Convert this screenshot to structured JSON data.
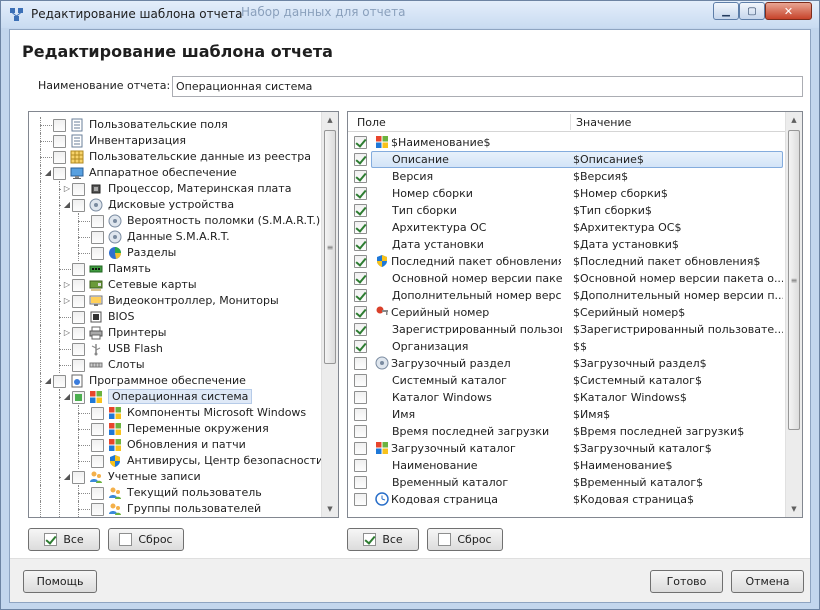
{
  "window": {
    "title": "Редактирование шаблона отчета",
    "ghost_title": "Набор данных для отчета",
    "buttons": {
      "min": "▁",
      "max": "▢",
      "close": "✕"
    }
  },
  "heading": "Редактирование шаблона отчета",
  "report_name": {
    "label": "Наименование отчета:",
    "value": "Операционная система"
  },
  "tree": {
    "items": [
      {
        "label": "Пользовательские поля",
        "level": 0,
        "state": "unchecked",
        "icon": "list-icon",
        "expand": ""
      },
      {
        "label": "Инвентаризация",
        "level": 0,
        "state": "unchecked",
        "icon": "list-icon",
        "expand": ""
      },
      {
        "label": "Пользовательские данные из реестра",
        "level": 0,
        "state": "unchecked",
        "icon": "grid-icon",
        "expand": ""
      },
      {
        "label": "Аппаратное обеспечение",
        "level": 0,
        "state": "unchecked",
        "icon": "monitor-icon",
        "expand": "◢"
      },
      {
        "label": "Процессор, Материнская плата",
        "level": 1,
        "state": "unchecked",
        "icon": "cpu-icon",
        "expand": "▷"
      },
      {
        "label": "Дисковые устройства",
        "level": 1,
        "state": "unchecked",
        "icon": "disk-icon",
        "expand": "◢"
      },
      {
        "label": "Вероятность поломки (S.M.A.R.T.)",
        "level": 2,
        "state": "unchecked",
        "icon": "disk-icon",
        "expand": ""
      },
      {
        "label": "Данные S.M.A.R.T.",
        "level": 2,
        "state": "unchecked",
        "icon": "disk-icon",
        "expand": ""
      },
      {
        "label": "Разделы",
        "level": 2,
        "state": "unchecked",
        "icon": "pie-icon",
        "expand": ""
      },
      {
        "label": "Память",
        "level": 1,
        "state": "unchecked",
        "icon": "memory-icon",
        "expand": ""
      },
      {
        "label": "Сетевые карты",
        "level": 1,
        "state": "unchecked",
        "icon": "network-card-icon",
        "expand": "▷"
      },
      {
        "label": "Видеоконтроллер, Мониторы",
        "level": 1,
        "state": "unchecked",
        "icon": "video-icon",
        "expand": "▷"
      },
      {
        "label": "BIOS",
        "level": 1,
        "state": "unchecked",
        "icon": "bios-icon",
        "expand": ""
      },
      {
        "label": "Принтеры",
        "level": 1,
        "state": "unchecked",
        "icon": "printer-icon",
        "expand": "▷"
      },
      {
        "label": "USB Flash",
        "level": 1,
        "state": "unchecked",
        "icon": "usb-icon",
        "expand": ""
      },
      {
        "label": "Слоты",
        "level": 1,
        "state": "unchecked",
        "icon": "slot-icon",
        "expand": ""
      },
      {
        "label": "Программное обеспечение",
        "level": 0,
        "state": "unchecked",
        "icon": "software-icon",
        "expand": "◢"
      },
      {
        "label": "Операционная система",
        "level": 1,
        "state": "partial",
        "icon": "windows-icon",
        "expand": "◢",
        "selected": true
      },
      {
        "label": "Компоненты Microsoft Windows",
        "level": 2,
        "state": "unchecked",
        "icon": "windows-icon",
        "expand": ""
      },
      {
        "label": "Переменные окружения",
        "level": 2,
        "state": "unchecked",
        "icon": "windows-icon",
        "expand": ""
      },
      {
        "label": "Обновления и патчи",
        "level": 2,
        "state": "unchecked",
        "icon": "windows-icon",
        "expand": ""
      },
      {
        "label": "Антивирусы, Центр безопасности",
        "level": 2,
        "state": "unchecked",
        "icon": "shield-icon",
        "expand": ""
      },
      {
        "label": "Учетные записи",
        "level": 1,
        "state": "unchecked",
        "icon": "users-icon",
        "expand": "◢"
      },
      {
        "label": "Текущий пользователь",
        "level": 2,
        "state": "unchecked",
        "icon": "users-icon",
        "expand": ""
      },
      {
        "label": "Группы пользователей",
        "level": 2,
        "state": "unchecked",
        "icon": "users-icon",
        "expand": ""
      }
    ]
  },
  "grid": {
    "headers": {
      "field": "Поле",
      "value": "Значение"
    },
    "rows": [
      {
        "field": "$Наименование$",
        "value": "",
        "checked": true,
        "icon": "windows-icon",
        "group": true
      },
      {
        "field": "Описание",
        "value": "$Описание$",
        "checked": true,
        "selected": true
      },
      {
        "field": "Версия",
        "value": "$Версия$",
        "checked": true
      },
      {
        "field": "Номер сборки",
        "value": "$Номер сборки$",
        "checked": true
      },
      {
        "field": "Тип сборки",
        "value": "$Тип сборки$",
        "checked": true
      },
      {
        "field": "Архитектура ОС",
        "value": "$Архитектура ОС$",
        "checked": true
      },
      {
        "field": "Дата установки",
        "value": "$Дата установки$",
        "checked": true
      },
      {
        "field": "Последний пакет обновления",
        "value": "$Последний пакет обновления$",
        "checked": true,
        "icon": "shield-icon",
        "group": true
      },
      {
        "field": "Основной номер версии пакета о...",
        "value": "$Основной номер версии пакета о...",
        "checked": true
      },
      {
        "field": "Дополнительный номер версии...",
        "value": "$Дополнительный номер версии п...",
        "checked": true
      },
      {
        "field": "Серийный номер",
        "value": "$Серийный номер$",
        "checked": true,
        "icon": "key-icon",
        "group": true
      },
      {
        "field": "Зарегистрированный пользов...",
        "value": "$Зарегистрированный пользовате...",
        "checked": true
      },
      {
        "field": "Организация",
        "value": "$$",
        "checked": true
      },
      {
        "field": "Загрузочный раздел",
        "value": "$Загрузочный раздел$",
        "checked": false,
        "icon": "disk-icon",
        "group": true
      },
      {
        "field": "Системный каталог",
        "value": "$Системный каталог$",
        "checked": false
      },
      {
        "field": "Каталог Windows",
        "value": "$Каталог Windows$",
        "checked": false
      },
      {
        "field": "Имя",
        "value": "$Имя$",
        "checked": false
      },
      {
        "field": "Время последней загрузки",
        "value": "$Время последней загрузки$",
        "checked": false
      },
      {
        "field": "Загрузочный каталог",
        "value": "$Загрузочный каталог$",
        "checked": false,
        "icon": "windows-icon",
        "group": true
      },
      {
        "field": "Наименование",
        "value": "$Наименование$",
        "checked": false
      },
      {
        "field": "Временный каталог",
        "value": "$Временный каталог$",
        "checked": false
      },
      {
        "field": "Кодовая страница",
        "value": "$Кодовая страница$",
        "checked": false,
        "icon": "clock-icon",
        "group": true
      }
    ]
  },
  "buttons": {
    "all_left": "Все",
    "reset_left": "Сброс",
    "all_right": "Все",
    "reset_right": "Сброс",
    "help": "Помощь",
    "ok": "Готово",
    "cancel": "Отмена"
  },
  "colors": {
    "accent": "#3b7ddd",
    "check": "#2e7d32",
    "selection": "#d3e4f7"
  }
}
